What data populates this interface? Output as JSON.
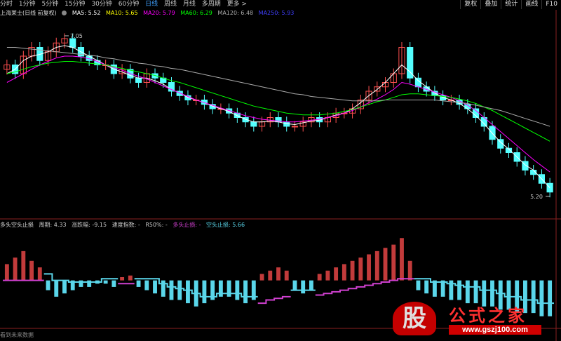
{
  "toolbar": {
    "tabs": [
      "分时",
      "1分钟",
      "5分钟",
      "15分钟",
      "30分钟",
      "60分钟",
      "日线",
      "周线",
      "月线",
      "多周期",
      "更多 >"
    ],
    "active_index": 6,
    "right_buttons": [
      "复权",
      "叠加",
      "统计",
      "画线",
      "F10"
    ]
  },
  "info": {
    "title": "上海莱士(日线 前复权)",
    "ma5": "MA5: 5.52",
    "ma10": "MA10: 5.65",
    "ma20": "MA20: 5.79",
    "ma60": "MA60: 6.29",
    "ma120": "MA120: 6.48",
    "ma250": "MA250: 5.93"
  },
  "indicator_info": {
    "name": "多头空头止损",
    "period": "周期: 4.33",
    "change": "涨跌幅: -9.15",
    "speed": "速度指数: -",
    "r50": "R50%: -",
    "long_stop": "多头止损: -",
    "short_stop": "空头止损: 5.66"
  },
  "annotations": {
    "high": "7.05",
    "low": "5.20"
  },
  "footer": "看到未来数据",
  "watermark": {
    "glyph": "股",
    "brand": "公式之家",
    "url": "www.gszj100.com"
  },
  "colors": {
    "up": "#ff5050",
    "down": "#54ffff",
    "ma5": "#ffffff",
    "ma10": "#ffff00",
    "ma20": "#ff00ff",
    "ma60": "#00ff00",
    "ma250": "#3f3fff",
    "ind_up": "#c23b3b",
    "ind_down": "#5ad6ea",
    "long_stop": "#d040d0",
    "short_stop": "#5ad6ea"
  },
  "chart_data": {
    "type": "candlestick",
    "ylim": [
      5.0,
      7.2
    ],
    "main_close": [
      6.7,
      6.6,
      6.8,
      6.9,
      6.75,
      6.85,
      6.95,
      7.0,
      6.9,
      6.8,
      6.75,
      6.7,
      6.7,
      6.6,
      6.65,
      6.55,
      6.5,
      6.6,
      6.55,
      6.5,
      6.4,
      6.35,
      6.3,
      6.3,
      6.25,
      6.2,
      6.2,
      6.15,
      6.1,
      6.05,
      6.0,
      6.05,
      6.1,
      6.05,
      6.0,
      6.0,
      6.05,
      6.1,
      6.05,
      6.1,
      6.15,
      6.15,
      6.2,
      6.3,
      6.4,
      6.45,
      6.5,
      6.6,
      6.9,
      6.55,
      6.45,
      6.4,
      6.35,
      6.3,
      6.3,
      6.25,
      6.2,
      6.1,
      6.0,
      5.85,
      5.75,
      5.7,
      5.6,
      5.5,
      5.45,
      5.35,
      5.25
    ],
    "ma_series": [
      {
        "name": "MA5",
        "values": [
          6.6,
          6.65,
          6.75,
          6.8,
          6.82,
          6.85,
          6.9,
          6.92,
          6.9,
          6.85,
          6.8,
          6.75,
          6.7,
          6.65,
          6.62,
          6.58,
          6.55,
          6.55,
          6.52,
          6.48,
          6.42,
          6.38,
          6.33,
          6.3,
          6.27,
          6.23,
          6.2,
          6.17,
          6.12,
          6.08,
          6.05,
          6.05,
          6.06,
          6.05,
          6.03,
          6.02,
          6.04,
          6.06,
          6.07,
          6.1,
          6.13,
          6.15,
          6.2,
          6.27,
          6.35,
          6.42,
          6.5,
          6.6,
          6.7,
          6.62,
          6.52,
          6.45,
          6.38,
          6.33,
          6.3,
          6.26,
          6.2,
          6.12,
          6.03,
          5.92,
          5.82,
          5.74,
          5.65,
          5.56,
          5.5,
          5.4,
          5.3
        ]
      },
      {
        "name": "MA20",
        "values": [
          6.5,
          6.55,
          6.6,
          6.65,
          6.7,
          6.74,
          6.78,
          6.8,
          6.8,
          6.79,
          6.77,
          6.74,
          6.7,
          6.67,
          6.64,
          6.6,
          6.57,
          6.54,
          6.5,
          6.46,
          6.42,
          6.38,
          6.34,
          6.3,
          6.27,
          6.24,
          6.21,
          6.18,
          6.15,
          6.12,
          6.1,
          6.08,
          6.07,
          6.06,
          6.05,
          6.05,
          6.06,
          6.07,
          6.08,
          6.1,
          6.12,
          6.15,
          6.18,
          6.22,
          6.27,
          6.31,
          6.36,
          6.42,
          6.5,
          6.48,
          6.45,
          6.42,
          6.39,
          6.36,
          6.33,
          6.29,
          6.24,
          6.18,
          6.1,
          6.02,
          5.94,
          5.86,
          5.78,
          5.7,
          5.62,
          5.55,
          5.48
        ]
      },
      {
        "name": "MA60",
        "values": [
          6.6,
          6.62,
          6.65,
          6.68,
          6.7,
          6.72,
          6.73,
          6.74,
          6.74,
          6.73,
          6.72,
          6.71,
          6.7,
          6.68,
          6.66,
          6.64,
          6.62,
          6.6,
          6.58,
          6.55,
          6.52,
          6.5,
          6.47,
          6.44,
          6.41,
          6.38,
          6.35,
          6.32,
          6.29,
          6.26,
          6.23,
          6.21,
          6.19,
          6.17,
          6.15,
          6.14,
          6.13,
          6.13,
          6.13,
          6.14,
          6.15,
          6.17,
          6.19,
          6.22,
          6.25,
          6.28,
          6.3,
          6.33,
          6.36,
          6.37,
          6.37,
          6.36,
          6.35,
          6.34,
          6.33,
          6.31,
          6.29,
          6.26,
          6.22,
          6.18,
          6.13,
          6.08,
          6.03,
          5.98,
          5.93,
          5.88,
          5.83
        ]
      },
      {
        "name": "MA120",
        "values": [
          6.9,
          6.9,
          6.89,
          6.88,
          6.87,
          6.86,
          6.85,
          6.84,
          6.83,
          6.82,
          6.81,
          6.8,
          6.78,
          6.77,
          6.75,
          6.74,
          6.72,
          6.71,
          6.69,
          6.68,
          6.66,
          6.65,
          6.63,
          6.61,
          6.59,
          6.57,
          6.55,
          6.53,
          6.51,
          6.49,
          6.47,
          6.45,
          6.43,
          6.41,
          6.39,
          6.37,
          6.36,
          6.34,
          6.33,
          6.32,
          6.31,
          6.3,
          6.29,
          6.29,
          6.29,
          6.29,
          6.3,
          6.3,
          6.3,
          6.3,
          6.3,
          6.3,
          6.3,
          6.29,
          6.28,
          6.27,
          6.26,
          6.24,
          6.22,
          6.2,
          6.18,
          6.15,
          6.12,
          6.09,
          6.06,
          6.03,
          6.0
        ]
      }
    ],
    "indicator": {
      "bars": [
        0.5,
        0.7,
        0.9,
        0.6,
        0.4,
        -0.3,
        -0.5,
        -0.4,
        -0.3,
        -0.2,
        -0.2,
        -0.1,
        -0.1,
        -0.2,
        0.1,
        0.15,
        -0.2,
        -0.3,
        -0.4,
        -0.5,
        -0.6,
        -0.6,
        -0.7,
        -0.8,
        -0.7,
        -0.6,
        -0.5,
        -0.5,
        -0.6,
        -0.7,
        -0.6,
        0.2,
        0.3,
        0.4,
        0.3,
        -0.3,
        -0.4,
        -0.3,
        0.2,
        0.3,
        0.4,
        0.5,
        0.6,
        0.7,
        0.8,
        0.9,
        1.0,
        1.1,
        1.3,
        0.6,
        -0.3,
        -0.4,
        -0.5,
        -0.5,
        -0.6,
        -0.6,
        -0.7,
        -0.7,
        -0.8,
        -0.8,
        -0.9,
        -0.9,
        -1.0,
        -1.0,
        -1.0,
        -1.1,
        -1.1
      ],
      "long_stop": [
        0.0,
        0.0,
        0.0,
        0.0,
        0.0,
        null,
        null,
        null,
        null,
        null,
        null,
        null,
        null,
        null,
        -0.1,
        -0.1,
        null,
        null,
        null,
        null,
        null,
        null,
        null,
        null,
        null,
        null,
        null,
        null,
        null,
        null,
        null,
        -0.7,
        -0.6,
        -0.55,
        -0.5,
        null,
        null,
        null,
        -0.45,
        -0.4,
        -0.35,
        -0.3,
        -0.25,
        -0.2,
        -0.15,
        -0.1,
        -0.05,
        0.0,
        0.05,
        0.05,
        null,
        null,
        null,
        null,
        null,
        null,
        null,
        null,
        null,
        null,
        null,
        null,
        null,
        null,
        null,
        null,
        null
      ],
      "short_stop": [
        null,
        null,
        null,
        null,
        null,
        0.2,
        0.0,
        0.0,
        -0.05,
        -0.05,
        -0.05,
        -0.05,
        0.05,
        0.05,
        null,
        null,
        0.05,
        0.05,
        0.05,
        -0.1,
        -0.2,
        -0.25,
        -0.3,
        -0.4,
        -0.5,
        -0.5,
        -0.4,
        -0.4,
        -0.4,
        -0.5,
        -0.5,
        null,
        null,
        null,
        null,
        -0.3,
        -0.3,
        -0.3,
        null,
        null,
        null,
        null,
        null,
        null,
        null,
        null,
        null,
        null,
        null,
        null,
        0.05,
        0.05,
        -0.05,
        -0.05,
        -0.1,
        -0.15,
        -0.2,
        -0.2,
        -0.3,
        -0.3,
        -0.4,
        -0.5,
        -0.5,
        -0.6,
        -0.6,
        -0.7,
        -0.7
      ]
    }
  }
}
